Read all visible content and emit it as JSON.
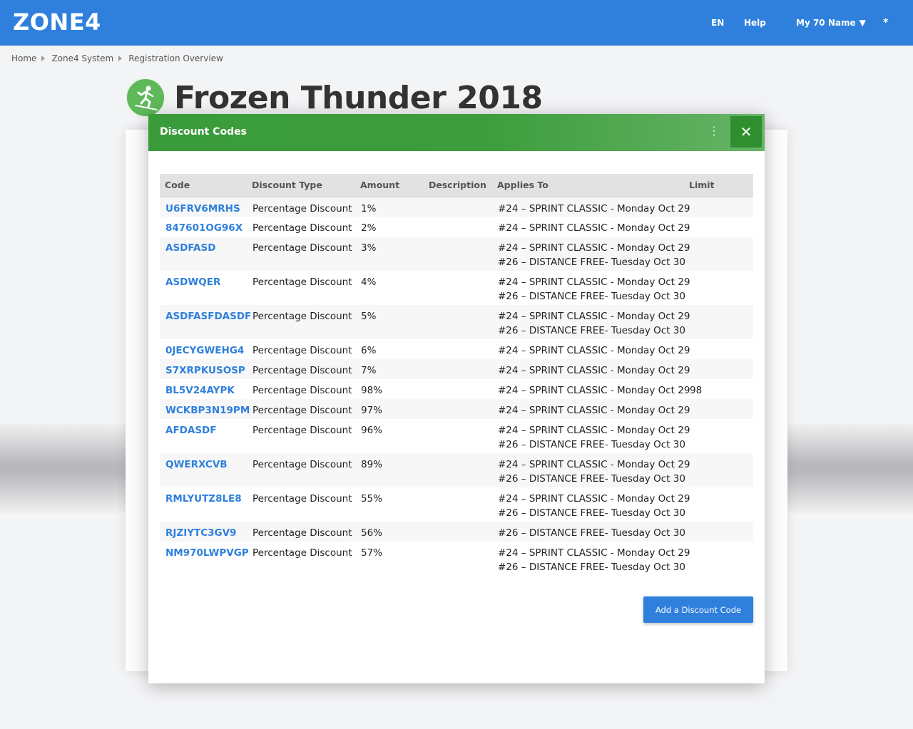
{
  "header": {
    "logo": "ZONE4",
    "lang": "EN",
    "help": "Help",
    "user": "My 70 Name",
    "menu_glyph": "*"
  },
  "breadcrumb": [
    "Home",
    "Zone4 System",
    "Registration Overview"
  ],
  "event": {
    "title": "Frozen Thunder 2018",
    "icon": "skier-icon"
  },
  "modal": {
    "title": "Discount Codes",
    "columns": [
      "Code",
      "Discount Type",
      "Amount",
      "Description",
      "Applies To",
      "Limit"
    ],
    "rows": [
      {
        "code": "U6FRV6MRHS",
        "type": "Percentage Discount",
        "amount": "1%",
        "description": "",
        "applies": [
          "#24 – SPRINT CLASSIC - Monday Oct 29"
        ],
        "limit": ""
      },
      {
        "code": "847601OG96X",
        "type": "Percentage Discount",
        "amount": "2%",
        "description": "",
        "applies": [
          "#24 – SPRINT CLASSIC - Monday Oct 29"
        ],
        "limit": ""
      },
      {
        "code": "ASDFASD",
        "type": "Percentage Discount",
        "amount": "3%",
        "description": "",
        "applies": [
          "#24 – SPRINT CLASSIC - Monday Oct 29",
          "#26 – DISTANCE FREE- Tuesday Oct 30"
        ],
        "limit": ""
      },
      {
        "code": "ASDWQER",
        "type": "Percentage Discount",
        "amount": "4%",
        "description": "",
        "applies": [
          "#24 – SPRINT CLASSIC - Monday Oct 29",
          "#26 – DISTANCE FREE- Tuesday Oct 30"
        ],
        "limit": ""
      },
      {
        "code": "ASDFASFDASDF",
        "type": "Percentage Discount",
        "amount": "5%",
        "description": "",
        "applies": [
          "#24 – SPRINT CLASSIC - Monday Oct 29",
          "#26 – DISTANCE FREE- Tuesday Oct 30"
        ],
        "limit": ""
      },
      {
        "code": "0JECYGWEHG4",
        "type": "Percentage Discount",
        "amount": "6%",
        "description": "",
        "applies": [
          "#24 – SPRINT CLASSIC - Monday Oct 29"
        ],
        "limit": ""
      },
      {
        "code": "S7XRPKUSOSP",
        "type": "Percentage Discount",
        "amount": "7%",
        "description": "",
        "applies": [
          "#24 – SPRINT CLASSIC - Monday Oct 29"
        ],
        "limit": ""
      },
      {
        "code": "BL5V24AYPK",
        "type": "Percentage Discount",
        "amount": "98%",
        "description": "",
        "applies": [
          "#24 – SPRINT CLASSIC - Monday Oct 29"
        ],
        "limit": "98"
      },
      {
        "code": "WCKBP3N19PM",
        "type": "Percentage Discount",
        "amount": "97%",
        "description": "",
        "applies": [
          "#24 – SPRINT CLASSIC - Monday Oct 29"
        ],
        "limit": ""
      },
      {
        "code": "AFDASDF",
        "type": "Percentage Discount",
        "amount": "96%",
        "description": "",
        "applies": [
          "#24 – SPRINT CLASSIC - Monday Oct 29",
          "#26 – DISTANCE FREE- Tuesday Oct 30"
        ],
        "limit": ""
      },
      {
        "code": "QWERXCVB",
        "type": "Percentage Discount",
        "amount": "89%",
        "description": "",
        "applies": [
          "#24 – SPRINT CLASSIC - Monday Oct 29",
          "#26 – DISTANCE FREE- Tuesday Oct 30"
        ],
        "limit": ""
      },
      {
        "code": "RMLYUTZ8LE8",
        "type": "Percentage Discount",
        "amount": "55%",
        "description": "",
        "applies": [
          "#24 – SPRINT CLASSIC - Monday Oct 29",
          "#26 – DISTANCE FREE- Tuesday Oct 30"
        ],
        "limit": ""
      },
      {
        "code": "RJZIYTC3GV9",
        "type": "Percentage Discount",
        "amount": "56%",
        "description": "",
        "applies": [
          "#26 – DISTANCE FREE- Tuesday Oct 30"
        ],
        "limit": ""
      },
      {
        "code": "NM970LWPVGP",
        "type": "Percentage Discount",
        "amount": "57%",
        "description": "",
        "applies": [
          "#24 – SPRINT CLASSIC - Monday Oct 29",
          "#26 – DISTANCE FREE- Tuesday Oct 30"
        ],
        "limit": ""
      }
    ],
    "add_button": "Add a Discount Code"
  },
  "colors": {
    "brand_blue": "#2f80dd",
    "header_green": "#3a9b3a",
    "icon_green": "#5fb85a"
  }
}
